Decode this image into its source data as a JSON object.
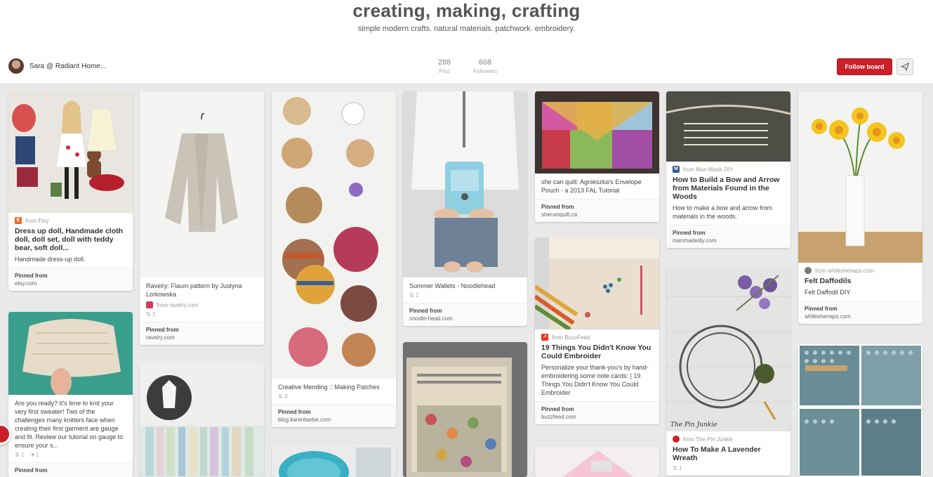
{
  "board": {
    "title": "creating, making, crafting",
    "description": "simple modern crafts. natural materials. patchwork. embroidery.",
    "owner": "Sara @ Radiant Home...",
    "pins_count": "288",
    "pins_label": "Pins",
    "followers_count": "608",
    "followers_label": "Followers",
    "follow_label": "Follow board"
  },
  "colors": {
    "accent": "#cb2027",
    "background": "#e9e9e9"
  },
  "pins": [
    {
      "source": "from Etsy",
      "source_icon": "etsy-icon",
      "title": "Dress up doll, Handmade cloth doll, doll set, doll with teddy bear, soft doll...",
      "desc": "Handmade dress-up doll.",
      "pinned_from": "Pinned from",
      "domain": "etsy.com"
    },
    {
      "source": "",
      "title": "",
      "desc": "Are you ready? It's time to knit your very first sweater! Two of the challenges many knitters face when creating their first garment are gauge and fit. Review our tutorial on gauge to ensure your s...",
      "repins": "1",
      "likes": "1",
      "pinned_from": "Pinned from"
    },
    {
      "desc": "Ravelry: Flaum pattern by Justyna Lorkowska",
      "source": "from ravelry.com",
      "repins": "1",
      "pinned_from": "Pinned from",
      "domain": "ravelry.com"
    },
    {
      "desc": "Creative Mending :: Making Patches",
      "repins": "3",
      "pinned_from": "Pinned from",
      "domain": "blog.karenbarbe.com"
    },
    {
      "desc": "Summer Wallets - Noodlehead",
      "repins": "1",
      "pinned_from": "Pinned from",
      "domain": "noodle-head.com"
    },
    {
      "desc": "she can quilt: Agnieszka's Envelope Pouch - a 2013 FAL Tutorial",
      "pinned_from": "Pinned from",
      "domain": "shecanquilt.ca"
    },
    {
      "source": "from BuzzFeed",
      "title": "19 Things You Didn't Know You Could Embroider",
      "desc": "Personalize your thank-you's by hand-embroidering some note cards: | 19 Things You Didn't Know You Could Embroider",
      "pinned_from": "Pinned from",
      "domain": "buzzfeed.com"
    },
    {
      "source": "from Man Made DIY",
      "title": "How to Build a Bow and Arrow from Materials Found in the Woods",
      "desc": "How to make a bow and arrow from materials in the woods.",
      "pinned_from": "Pinned from",
      "domain": "manmadediy.com"
    },
    {
      "source": "from The Pin Junkie",
      "title": "How To Make A Lavender Wreath",
      "repins": "1",
      "img_caption": "The Pin Junkie"
    },
    {
      "source": "from whileshenaps.com",
      "title": "Felt Daffodils",
      "desc": "Felt Daffodil DIY",
      "pinned_from": "Pinned from",
      "domain": "whileshenaps.com"
    }
  ]
}
